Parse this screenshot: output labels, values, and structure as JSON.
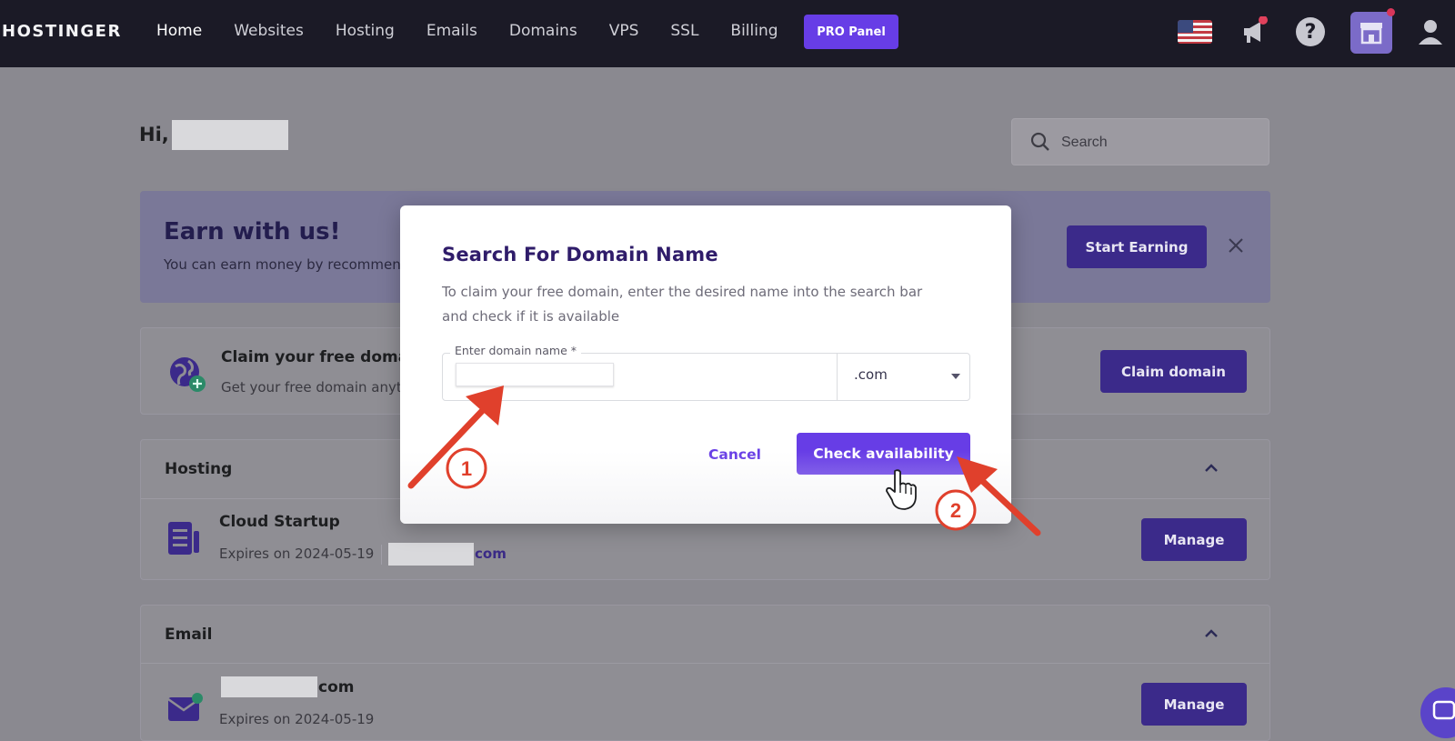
{
  "nav": {
    "brand": "HOSTINGER",
    "links": [
      "Home",
      "Websites",
      "Hosting",
      "Emails",
      "Domains",
      "VPS",
      "SSL",
      "Billing"
    ],
    "active_link": "Home",
    "pro_panel_label": "PRO Panel",
    "icons": [
      "us-flag-icon",
      "megaphone-icon",
      "help-icon",
      "store-icon",
      "user-icon"
    ]
  },
  "greeting": {
    "text": "Hi,"
  },
  "search": {
    "placeholder": "Search"
  },
  "earn_banner": {
    "title": "Earn with us!",
    "description": "You can earn money by recommenc",
    "button_label": "Start Earning"
  },
  "claim_domain": {
    "title": "Claim your free domai",
    "description": "Get your free domain anyti",
    "button_label": "Claim domain"
  },
  "hosting": {
    "section_title": "Hosting",
    "plan_name": "Cloud Startup",
    "expires": "Expires on 2024-05-19",
    "domain_suffix": "com",
    "manage_label": "Manage"
  },
  "email": {
    "section_title": "Email",
    "domain_suffix": "com",
    "expires": "Expires on 2024-05-19",
    "manage_label": "Manage"
  },
  "modal": {
    "title": "Search For Domain Name",
    "description": "To claim your free domain, enter the desired name into the search bar and check if it is available",
    "field_label": "Enter domain name *",
    "domain_value": "",
    "tld": ".com",
    "cancel_label": "Cancel",
    "check_label": "Check availability"
  },
  "annotations": {
    "step_1": "1",
    "step_2": "2"
  },
  "colors": {
    "brand_purple": "#673de6",
    "nav_bg": "#1b1a26",
    "annotation_red": "#e0402c"
  }
}
